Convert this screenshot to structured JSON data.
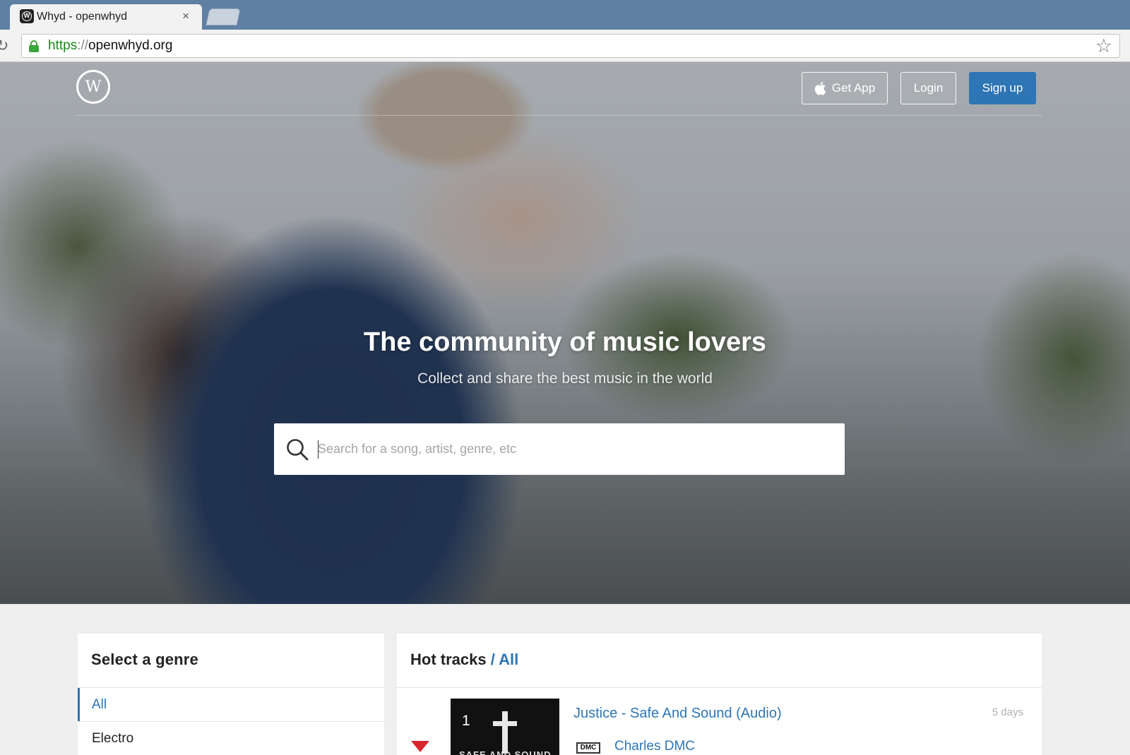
{
  "browser": {
    "tab_title": "Whyd - openwhyd",
    "tab_close": "×",
    "url_scheme": "https",
    "url_sep": "://",
    "url_host": "openwhyd.org"
  },
  "header": {
    "logo_letter": "W",
    "get_app_label": "Get App",
    "login_label": "Login",
    "signup_label": "Sign up"
  },
  "hero": {
    "title": "The community of music lovers",
    "subtitle": "Collect and share the best music in the world"
  },
  "search": {
    "placeholder": "Search for a song, artist, genre, etc",
    "value": ""
  },
  "genre_panel": {
    "heading": "Select a genre",
    "items": [
      {
        "label": "All",
        "active": true
      },
      {
        "label": "Electro",
        "active": false
      }
    ]
  },
  "tracks_panel": {
    "heading": "Hot tracks",
    "filter": "/ All",
    "tracks": [
      {
        "rank": "1",
        "title": "Justice - Safe And Sound (Audio)",
        "age": "5 days",
        "poster": "Charles DMC",
        "poster_badge": "DMC",
        "thumb_text": "SAFE AND SOUND"
      }
    ]
  },
  "colors": {
    "accent": "#2e75b6",
    "down_arrow": "#d9262e",
    "secure_green": "#1a8a1a"
  },
  "icons": [
    "lock-icon",
    "star-icon",
    "reload-icon",
    "apple-icon",
    "search-icon",
    "chevron-down-icon"
  ]
}
